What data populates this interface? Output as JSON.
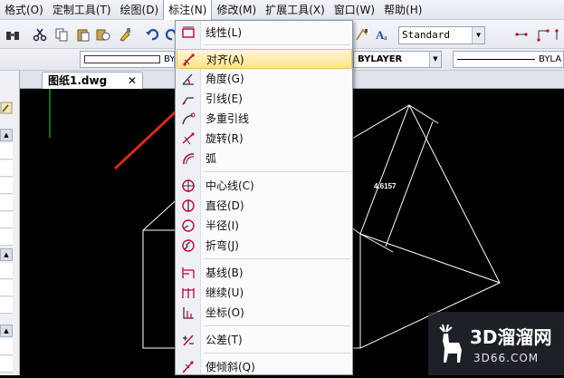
{
  "menubar": {
    "items": [
      "格式(O)",
      "定制工具(T)",
      "绘图(D)",
      "标注(N)",
      "修改(M)",
      "扩展工具(X)",
      "窗口(W)",
      "帮助(H)"
    ],
    "active_index": 3
  },
  "toolbar": {
    "text_style": "Standard"
  },
  "properties": {
    "layer_line_left": "BYL",
    "linetype": "BYLAYER",
    "lineweight": "BYLA"
  },
  "document_tab": {
    "title": "图纸1.dwg",
    "close": "✕"
  },
  "dimension_menu": {
    "items": [
      {
        "label": "线性(L)",
        "icon": "linear-dim-icon"
      },
      {
        "label": "对齐(A)",
        "icon": "aligned-dim-icon",
        "highlighted": true
      },
      {
        "label": "角度(G)",
        "icon": "angle-dim-icon"
      },
      {
        "label": "引线(E)",
        "icon": "leader-icon"
      },
      {
        "label": "多重引线",
        "icon": "multileader-icon"
      },
      {
        "label": "旋转(R)",
        "icon": "rotated-dim-icon"
      },
      {
        "label": "弧",
        "icon": "arc-dim-icon"
      },
      {
        "label": "中心线(C)",
        "icon": "centerline-icon"
      },
      {
        "label": "直径(D)",
        "icon": "diameter-icon"
      },
      {
        "label": "半径(I)",
        "icon": "radius-icon"
      },
      {
        "label": "折弯(J)",
        "icon": "jogged-icon"
      },
      {
        "label": "基线(B)",
        "icon": "baseline-icon"
      },
      {
        "label": "继续(U)",
        "icon": "continue-icon"
      },
      {
        "label": "坐标(O)",
        "icon": "ordinate-icon"
      },
      {
        "label": "公差(T)",
        "icon": "tolerance-icon"
      },
      {
        "label": "使倾斜(Q)",
        "icon": "oblique-icon"
      }
    ]
  },
  "drawing": {
    "dimension_value": "4.6157"
  },
  "watermark": {
    "brand": "3D溜溜网",
    "domain": "3D66.COM"
  },
  "colors": {
    "highlight": "#ffe48a",
    "annotation_arrow": "#e0241b",
    "canvas": "#000000",
    "cad_line": "#ffffff"
  }
}
